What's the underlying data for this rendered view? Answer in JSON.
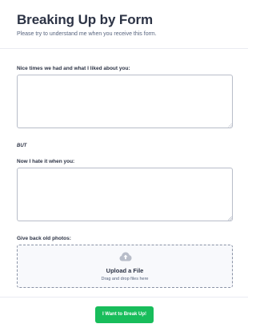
{
  "header": {
    "title": "Breaking Up by Form",
    "subtitle": "Please try to understand me when you receive this form."
  },
  "fields": {
    "nice_times": {
      "label": "Nice times we had and what I liked about you:",
      "value": ""
    },
    "but_text": "BUT",
    "hate": {
      "label": "Now I hate it when you:",
      "value": ""
    },
    "photos": {
      "label": "Give back old photos:",
      "upload_title": "Upload a File",
      "upload_hint": "Drag and drop files here",
      "icon": "cloud-upload-icon"
    }
  },
  "submit": {
    "label": "I Want to Break Up!",
    "color": "#18bd5b"
  },
  "colors": {
    "text": "#2c3345",
    "muted": "#57647e",
    "border": "#b8bdc9",
    "upload_bg": "#f8f9fc",
    "icon": "#b8bdc9"
  }
}
